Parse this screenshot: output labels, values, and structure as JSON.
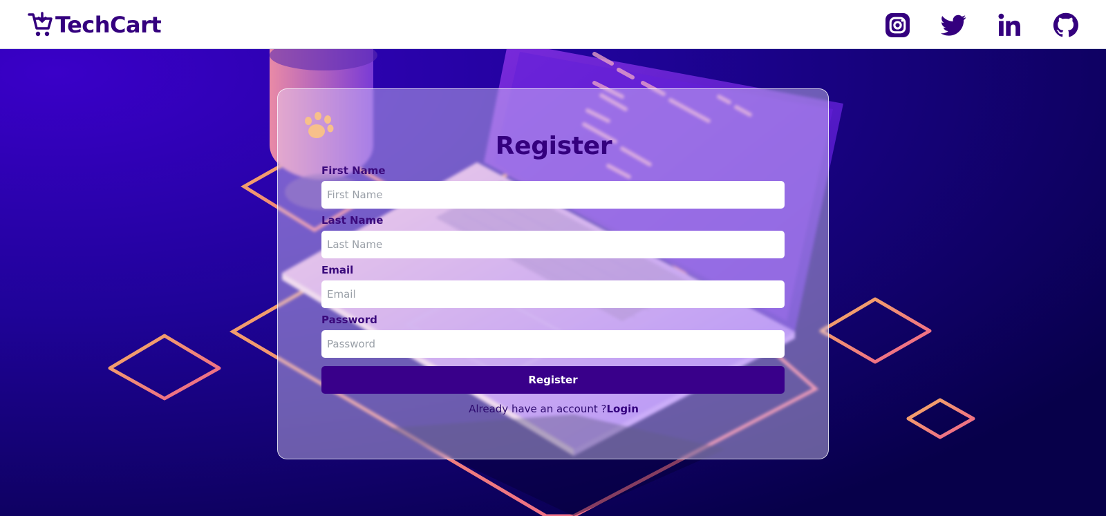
{
  "brand": {
    "name": "TechCart",
    "icon": "cart-icon"
  },
  "socials": [
    {
      "name": "instagram-icon"
    },
    {
      "name": "twitter-icon"
    },
    {
      "name": "linkedin-icon"
    },
    {
      "name": "github-icon"
    }
  ],
  "form": {
    "title": "Register",
    "fields": [
      {
        "label": "First Name",
        "placeholder": "First Name",
        "value": ""
      },
      {
        "label": "Last Name",
        "placeholder": "Last Name",
        "value": ""
      },
      {
        "label": "Email",
        "placeholder": "Email",
        "value": ""
      },
      {
        "label": "Password",
        "placeholder": "Password",
        "value": ""
      }
    ],
    "submit_label": "Register",
    "login_prompt": "Already have an account ?",
    "login_link": "Login"
  },
  "colors": {
    "brand": "#34007e",
    "button": "#39008a",
    "background_start": "#3a00c8",
    "background_end": "#07004a",
    "accent_orange": "#f3a062",
    "accent_pink": "#ee5f8f"
  }
}
